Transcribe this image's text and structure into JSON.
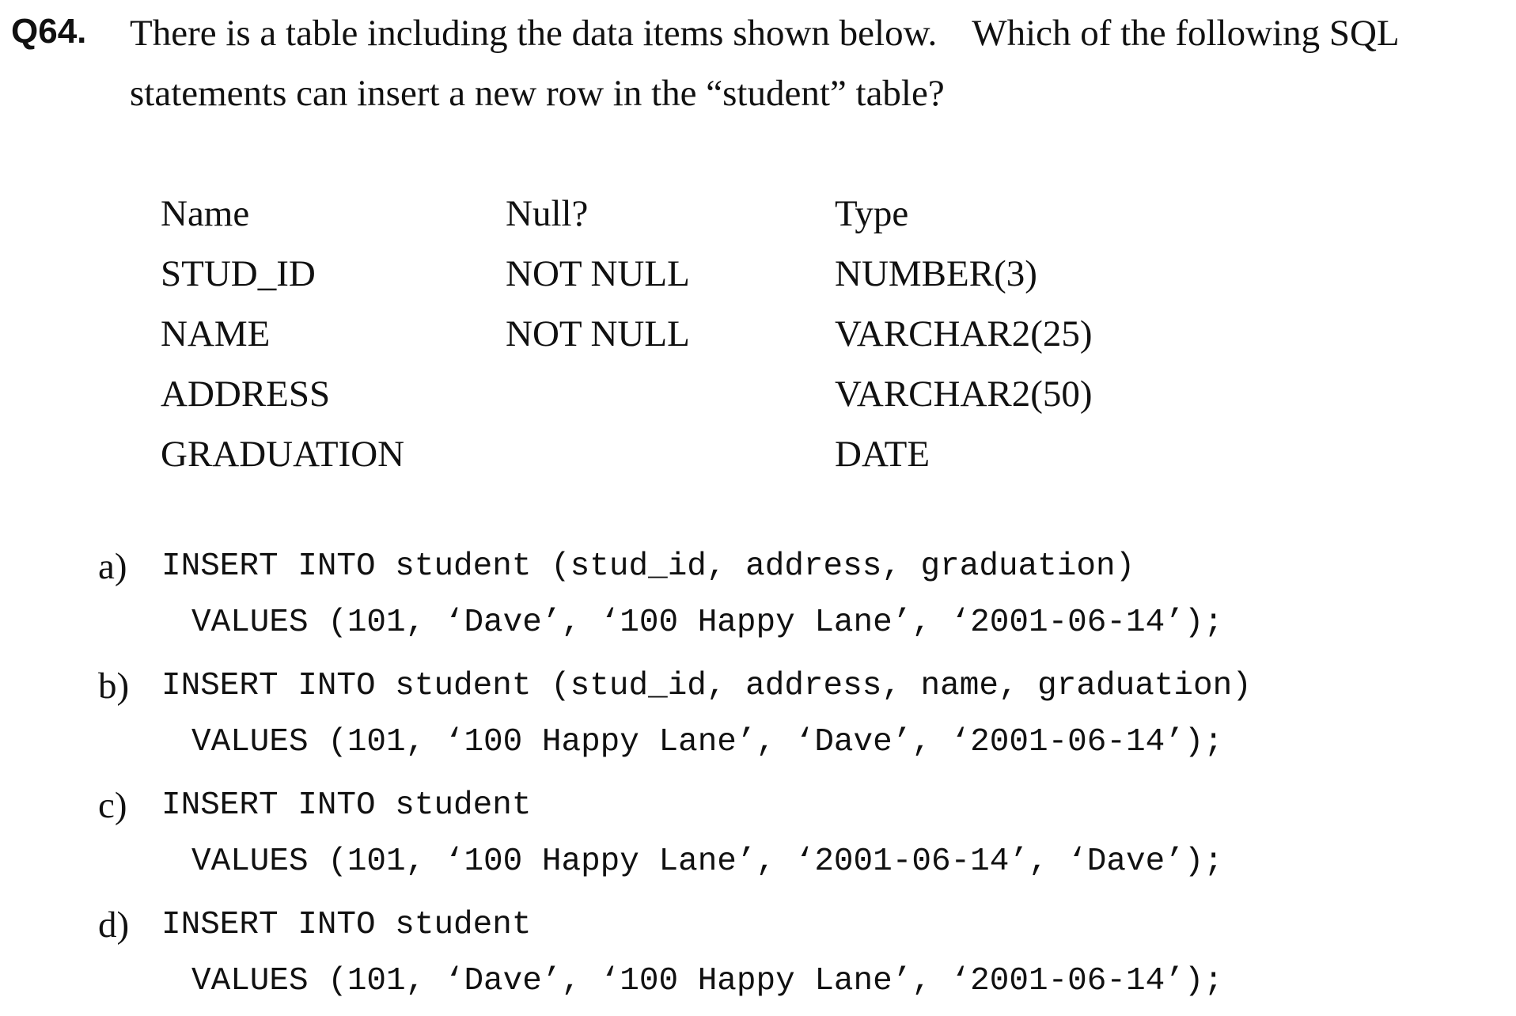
{
  "question": {
    "number": "Q64.",
    "line1_part1": "There is a table including the data items shown below.",
    "line1_part2": "Which of the following SQL",
    "line2": "statements can insert a new row in the “student” table?"
  },
  "schema": {
    "headers": {
      "name": "Name",
      "null": "Null?",
      "type": "Type"
    },
    "rows": [
      {
        "name": "STUD_ID",
        "null": "NOT NULL",
        "type": "NUMBER(3)"
      },
      {
        "name": "NAME",
        "null": "NOT NULL",
        "type": "VARCHAR2(25)"
      },
      {
        "name": "ADDRESS",
        "null": "",
        "type": "VARCHAR2(50)"
      },
      {
        "name": "GRADUATION",
        "null": "",
        "type": "DATE"
      }
    ]
  },
  "options": [
    {
      "label": "a)",
      "line1": "INSERT INTO student (stud_id, address, graduation)",
      "line2": "VALUES (101, ‘Dave’, ‘100 Happy Lane’, ‘2001-06-14’);"
    },
    {
      "label": "b)",
      "line1": "INSERT INTO student (stud_id, address, name, graduation)",
      "line2": "VALUES (101, ‘100 Happy Lane’, ‘Dave’, ‘2001-06-14’);"
    },
    {
      "label": "c)",
      "line1": "INSERT INTO student",
      "line2": "VALUES (101, ‘100 Happy Lane’, ‘2001-06-14’, ‘Dave’);"
    },
    {
      "label": "d)",
      "line1": "INSERT INTO student",
      "line2": "VALUES (101, ‘Dave’, ‘100 Happy Lane’, ‘2001-06-14’);"
    }
  ]
}
